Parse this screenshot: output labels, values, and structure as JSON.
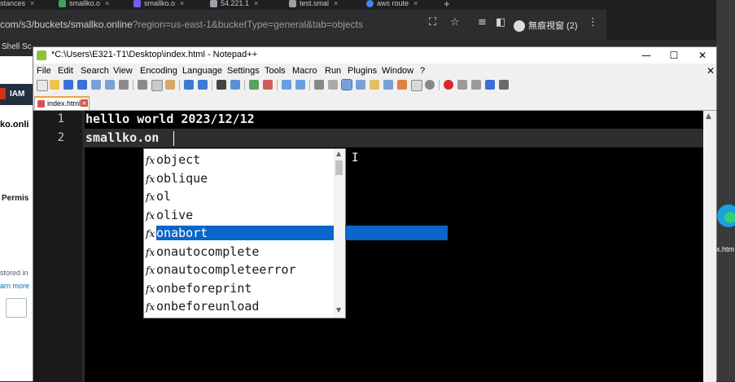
{
  "browser": {
    "tabs": [
      {
        "label": "stances",
        "color": "#888888"
      },
      {
        "label": "smallko.o",
        "color": "#3aa55d"
      },
      {
        "label": "smallko.o",
        "color": "#7a5af5"
      },
      {
        "label": "54.221.1",
        "color": "#9aa0a6"
      },
      {
        "label": "test.smal",
        "color": "#9aa0a6"
      },
      {
        "label": "aws route",
        "color": "#4285f4"
      }
    ],
    "new_tab": "+",
    "url_main": "com/s3/buckets/smallko.online",
    "url_query": "?region=us-east-1&bucketType=general&tab=objects",
    "profile_label": "無痕視窗 (2)",
    "bookmark_label": "Shell Sc"
  },
  "aws_page": {
    "service_label": "IAM",
    "bucket_fragment": "ko.onli",
    "perms_fragment": "Permis",
    "stored_fragment": "stored in",
    "learn_fragment": "arn more"
  },
  "desktop": {
    "file_label": "x.htm"
  },
  "notepad": {
    "title": "*C:\\Users\\E321-T1\\Desktop\\index.html - Notepad++",
    "menu": [
      "File",
      "Edit",
      "Search",
      "View",
      "Encoding",
      "Language",
      "Settings",
      "Tools",
      "Macro",
      "Run",
      "Plugins",
      "Window",
      "?"
    ],
    "doc_tab": "index.html",
    "lines": [
      {
        "num": "1",
        "text": "helllo world 2023/12/12"
      },
      {
        "num": "2",
        "text": "smallko.on"
      }
    ]
  },
  "autocomplete": {
    "icon_glyph": "fx",
    "items": [
      {
        "label": "object",
        "selected": false
      },
      {
        "label": "oblique",
        "selected": false
      },
      {
        "label": "ol",
        "selected": false
      },
      {
        "label": "olive",
        "selected": false
      },
      {
        "label": "onabort",
        "selected": true
      },
      {
        "label": "onautocomplete",
        "selected": false
      },
      {
        "label": "onautocompleteerror",
        "selected": false
      },
      {
        "label": "onbeforeprint",
        "selected": false
      },
      {
        "label": "onbeforeunload",
        "selected": false
      }
    ]
  },
  "colors": {
    "selection": "#0a66c8",
    "editor_bg": "#000000",
    "current_line": "#2e2e2e"
  }
}
